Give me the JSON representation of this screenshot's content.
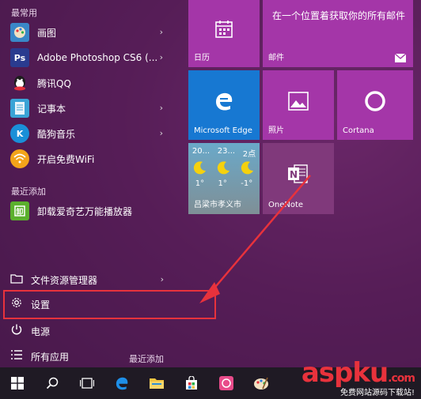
{
  "left_menu": {
    "frequent_title": "最常用",
    "frequent_items": [
      {
        "label": "画图",
        "icon": "paint-icon",
        "color": "#3a87c8"
      },
      {
        "label": "Adobe Photoshop CS6 (...",
        "icon": "photoshop-icon",
        "color": "#2a3b8f"
      },
      {
        "label": "腾讯QQ",
        "icon": "qq-icon",
        "color": "#1d1d1d"
      },
      {
        "label": "记事本",
        "icon": "notepad-icon",
        "color": "#3aa3d6"
      },
      {
        "label": "酷狗音乐",
        "icon": "kugou-icon",
        "color": "#1a8fd8"
      },
      {
        "label": "开启免费WiFi",
        "icon": "wifi-icon",
        "color": "#f3a41a"
      }
    ],
    "recent_title": "最近添加",
    "recent_items": [
      {
        "label": "卸载爱奇艺万能播放器",
        "icon": "iqiyi-icon",
        "color": "#5bb02d"
      }
    ],
    "bottom_items": [
      {
        "label": "文件资源管理器",
        "icon": "folder-icon"
      },
      {
        "label": "设置",
        "icon": "gear-icon"
      },
      {
        "label": "电源",
        "icon": "power-icon"
      },
      {
        "label": "所有应用",
        "icon": "list-icon"
      }
    ],
    "recent_added_badge": "最近添加"
  },
  "tiles": {
    "calendar": {
      "label": "日历",
      "color": "#a436a8"
    },
    "mail": {
      "label": "邮件",
      "text": "在一个位置着获取你的所有邮件",
      "color": "#a436a8"
    },
    "edge": {
      "label": "Microsoft Edge",
      "color": "#1778d2"
    },
    "photos": {
      "label": "照片",
      "color": "#a436a8"
    },
    "cortana": {
      "label": "Cortana",
      "color": "#a436a8"
    },
    "weather": {
      "label": "吕梁市孝义市",
      "days": [
        {
          "time": "20...",
          "temp": "1°"
        },
        {
          "time": "23...",
          "temp": "1°"
        },
        {
          "time": "2点",
          "temp": "-1°"
        }
      ]
    },
    "onenote": {
      "label": "OneNote",
      "color": "#80397b"
    }
  },
  "watermark": {
    "main": "aspku",
    "suffix": ".com",
    "sub": "免费网站源码下载站!"
  }
}
